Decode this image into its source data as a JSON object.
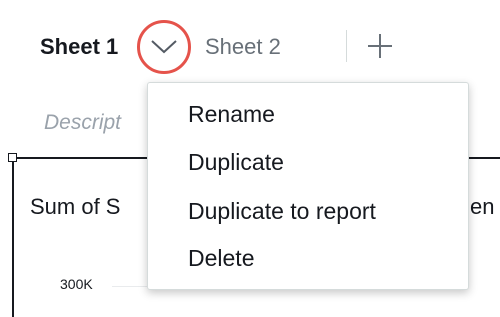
{
  "tabs": {
    "active_label": "Sheet 1",
    "inactive_label": "Sheet 2"
  },
  "description_placeholder": "Descript",
  "visual": {
    "title_fragment": "Sum of S",
    "title_fragment_right": "en",
    "y_tick": "300K"
  },
  "menu": {
    "items": [
      {
        "label": "Rename"
      },
      {
        "label": "Duplicate"
      },
      {
        "label": "Duplicate to report"
      },
      {
        "label": "Delete"
      }
    ]
  },
  "icons": {
    "tab_menu": "chevron-down-icon",
    "add_tab": "plus-icon"
  },
  "colors": {
    "highlight_ring": "#e5534b",
    "text": "#16191f",
    "muted_text": "#687078",
    "placeholder": "#9aa2ab"
  }
}
